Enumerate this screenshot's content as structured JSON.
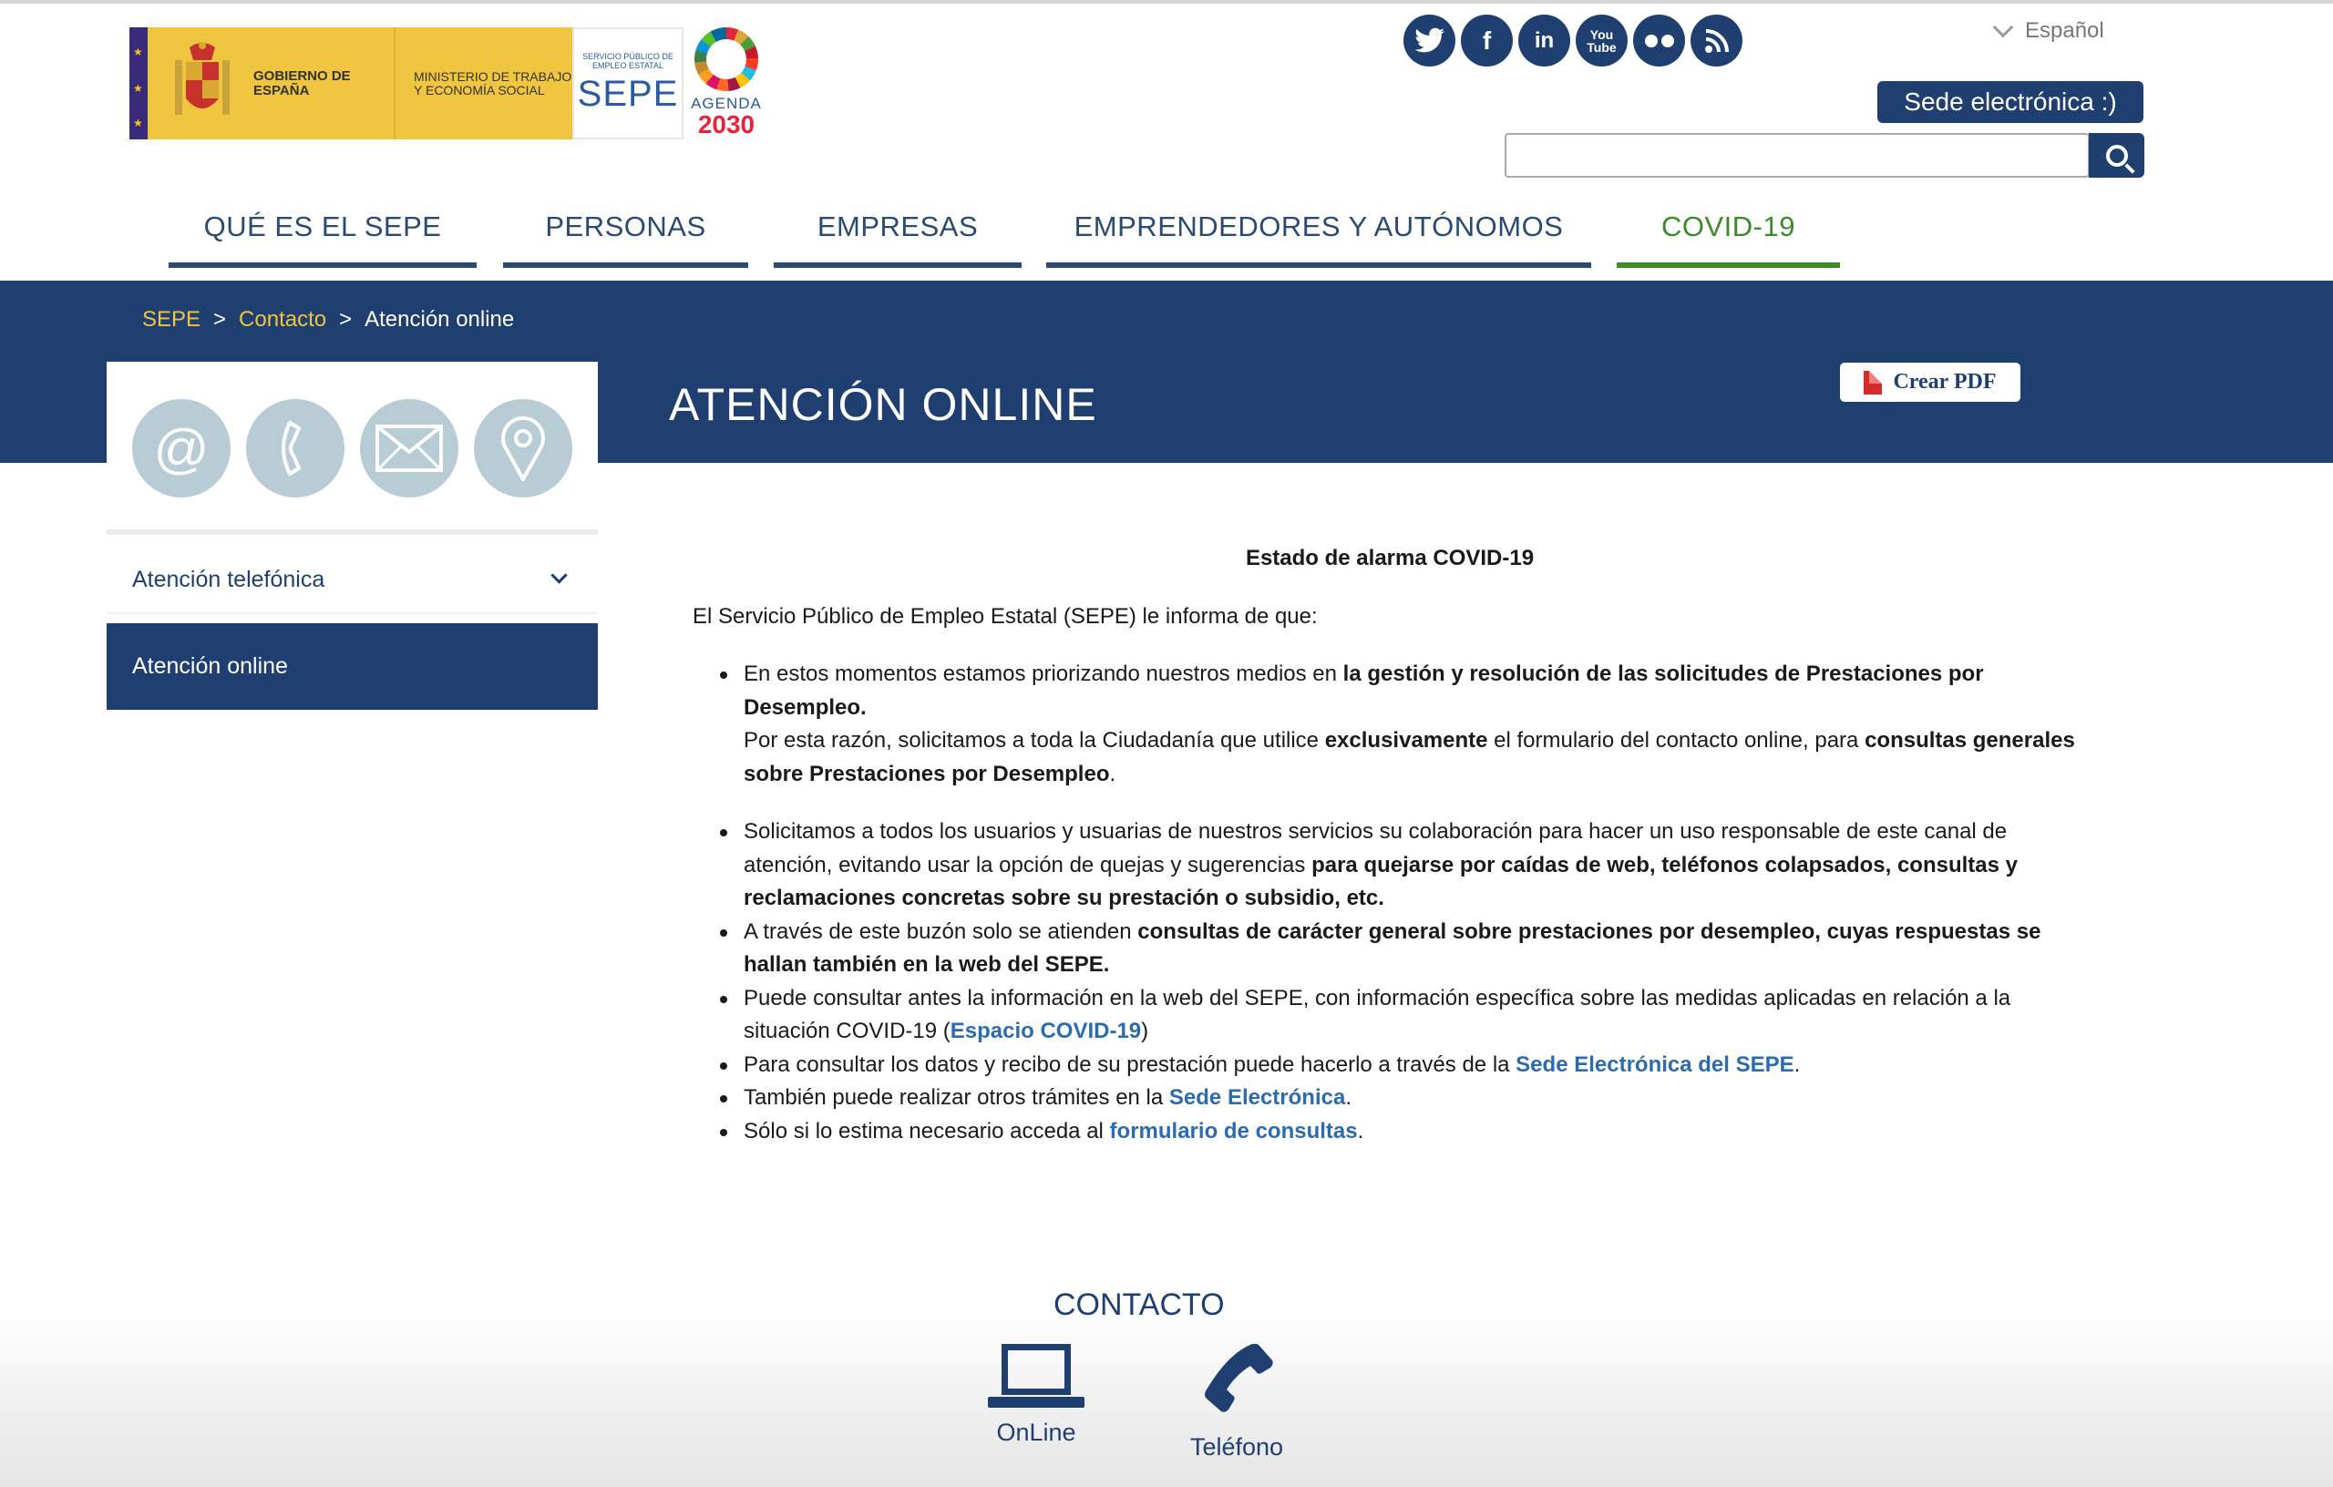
{
  "header": {
    "logo": {
      "gobierno": "GOBIERNO DE ESPAÑA",
      "ministerio": "MINISTERIO DE TRABAJO Y ECONOMÍA SOCIAL",
      "sepe_small": "SERVICIO PÚBLICO DE EMPLEO ESTATAL",
      "sepe": "SEPE",
      "agenda_line1": "AGENDA",
      "agenda_line2": "2030"
    },
    "socials": [
      "twitter-icon",
      "facebook-icon",
      "linkedin-icon",
      "youtube-icon",
      "flickr-icon",
      "rss-icon"
    ],
    "language": "Español",
    "sede_button": "Sede electrónica  :)",
    "search_placeholder": ""
  },
  "nav": {
    "items": [
      "QUÉ ES EL SEPE",
      "PERSONAS",
      "EMPRESAS",
      "EMPRENDEDORES Y AUTÓNOMOS",
      "COVID-19"
    ]
  },
  "breadcrumb": {
    "items": [
      "SEPE",
      "Contacto",
      "Atención online"
    ],
    "separator": ">"
  },
  "page": {
    "title": "ATENCIÓN ONLINE",
    "pdf_button": "Crear PDF"
  },
  "sidebar": {
    "icons": [
      "at-icon",
      "phone-icon",
      "mail-icon",
      "location-pin-icon"
    ],
    "items": [
      {
        "label": "Atención telefónica"
      },
      {
        "label": "Atención online"
      }
    ]
  },
  "content": {
    "heading": "Estado de alarma COVID-19",
    "intro": "El  Servicio Público de Empleo Estatal (SEPE) le informa  de que:",
    "b1": {
      "t1": "En estos momentos estamos  priorizando nuestros medios en ",
      "b1": "la gestión y resolución de las solicitudes de Prestaciones por Desempleo.",
      "t2": "Por esta razón, solicitamos a toda la Ciudadanía que utilice ",
      "b2": "exclusivamente",
      "t3": " el formulario del  contacto online, para ",
      "b3": "consultas generales sobre Prestaciones por Desempleo",
      "t4": "."
    },
    "b2": {
      "t1": "Solicitamos a todos los usuarios y usuarias de nuestros servicios su colaboración para hacer un uso responsable de este canal de atención, evitando usar la opción de quejas y sugerencias ",
      "b1": "para quejarse por caídas de web, teléfonos colapsados, consultas y reclamaciones concretas sobre su prestación o subsidio, etc."
    },
    "b3": {
      "t1": "A través de este buzón solo se atienden ",
      "b1": "consultas de carácter general sobre prestaciones por desempleo, cuyas respuestas  se hallan  también en la web del SEPE."
    },
    "b4": {
      "t1": "Puede consultar antes la información en  la web del SEPE, con información específica sobre las medidas aplicadas en relación a la situación COVID-19 (",
      "link": "Espacio COVID-19",
      "t2": ")"
    },
    "b5": {
      "t1": "Para consultar los datos y recibo de su prestación puede hacerlo a través de la ",
      "link": "Sede Electrónica del SEPE",
      "t2": "."
    },
    "b6": {
      "t1": "También puede realizar otros trámites en la ",
      "link": "Sede Electrónica",
      "t2": "."
    },
    "b7": {
      "t1": "Sólo si lo estima necesario acceda al ",
      "link": "formulario de consultas",
      "t2": "."
    }
  },
  "footer": {
    "title": "CONTACTO",
    "online": "OnLine",
    "telefono": "Teléfono"
  }
}
